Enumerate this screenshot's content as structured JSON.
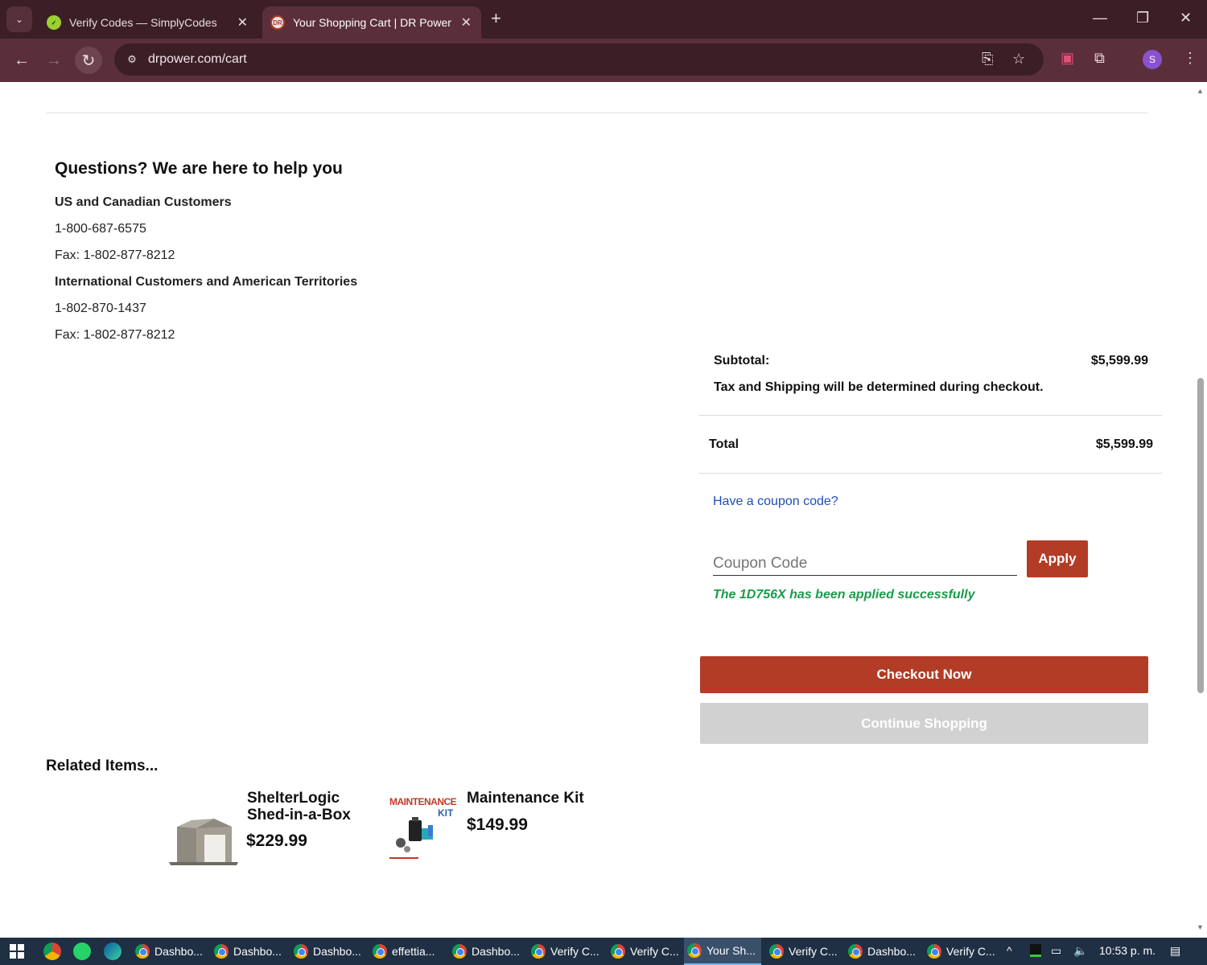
{
  "browser": {
    "tabs": [
      {
        "title": "Verify Codes — SimplyCodes",
        "favicon": "simplycodes-icon"
      },
      {
        "title": "Your Shopping Cart | DR Power",
        "favicon": "dr-power-icon"
      }
    ],
    "url": "drpower.com/cart"
  },
  "help": {
    "title": "Questions? We are here to help you",
    "us_heading": "US and Canadian Customers",
    "us_phone": "1-800-687-6575",
    "us_fax": "Fax: 1-802-877-8212",
    "intl_heading": "International Customers and American Territories",
    "intl_phone": "1-802-870-1437",
    "intl_fax": "Fax: 1-802-877-8212"
  },
  "summary": {
    "subtotal_label": "Subtotal:",
    "subtotal_value": "$5,599.99",
    "tax_note": "Tax and Shipping will be determined during checkout.",
    "total_label": "Total",
    "total_value": "$5,599.99"
  },
  "coupon": {
    "link": "Have a coupon code?",
    "placeholder": "Coupon Code",
    "apply_label": "Apply",
    "success_message": "The 1D756X has been applied successfully"
  },
  "actions": {
    "checkout_label": "Checkout Now",
    "continue_label": "Continue Shopping"
  },
  "related": {
    "title": "Related Items...",
    "items": [
      {
        "name_line1": "ShelterLogic",
        "name_line2": "Shed-in-a-Box",
        "price": "$229.99"
      },
      {
        "name_line1": "Maintenance Kit",
        "price": "$149.99",
        "image_text_1": "MAINTENANCE",
        "image_text_2": "KIT"
      }
    ]
  },
  "taskbar": {
    "items": [
      "Dashbo...",
      "Dashbo...",
      "Dashbo...",
      "effettia...",
      "Dashbo...",
      "Verify C...",
      "Verify C...",
      "Your Sh...",
      "Verify C...",
      "Dashbo...",
      "Verify C..."
    ],
    "time": "10:53 p. m."
  },
  "colors": {
    "brand_red": "#b23c25",
    "success_green": "#1a9c4a",
    "link_blue": "#1f4db8",
    "chrome_dark": "#3c1e27"
  }
}
